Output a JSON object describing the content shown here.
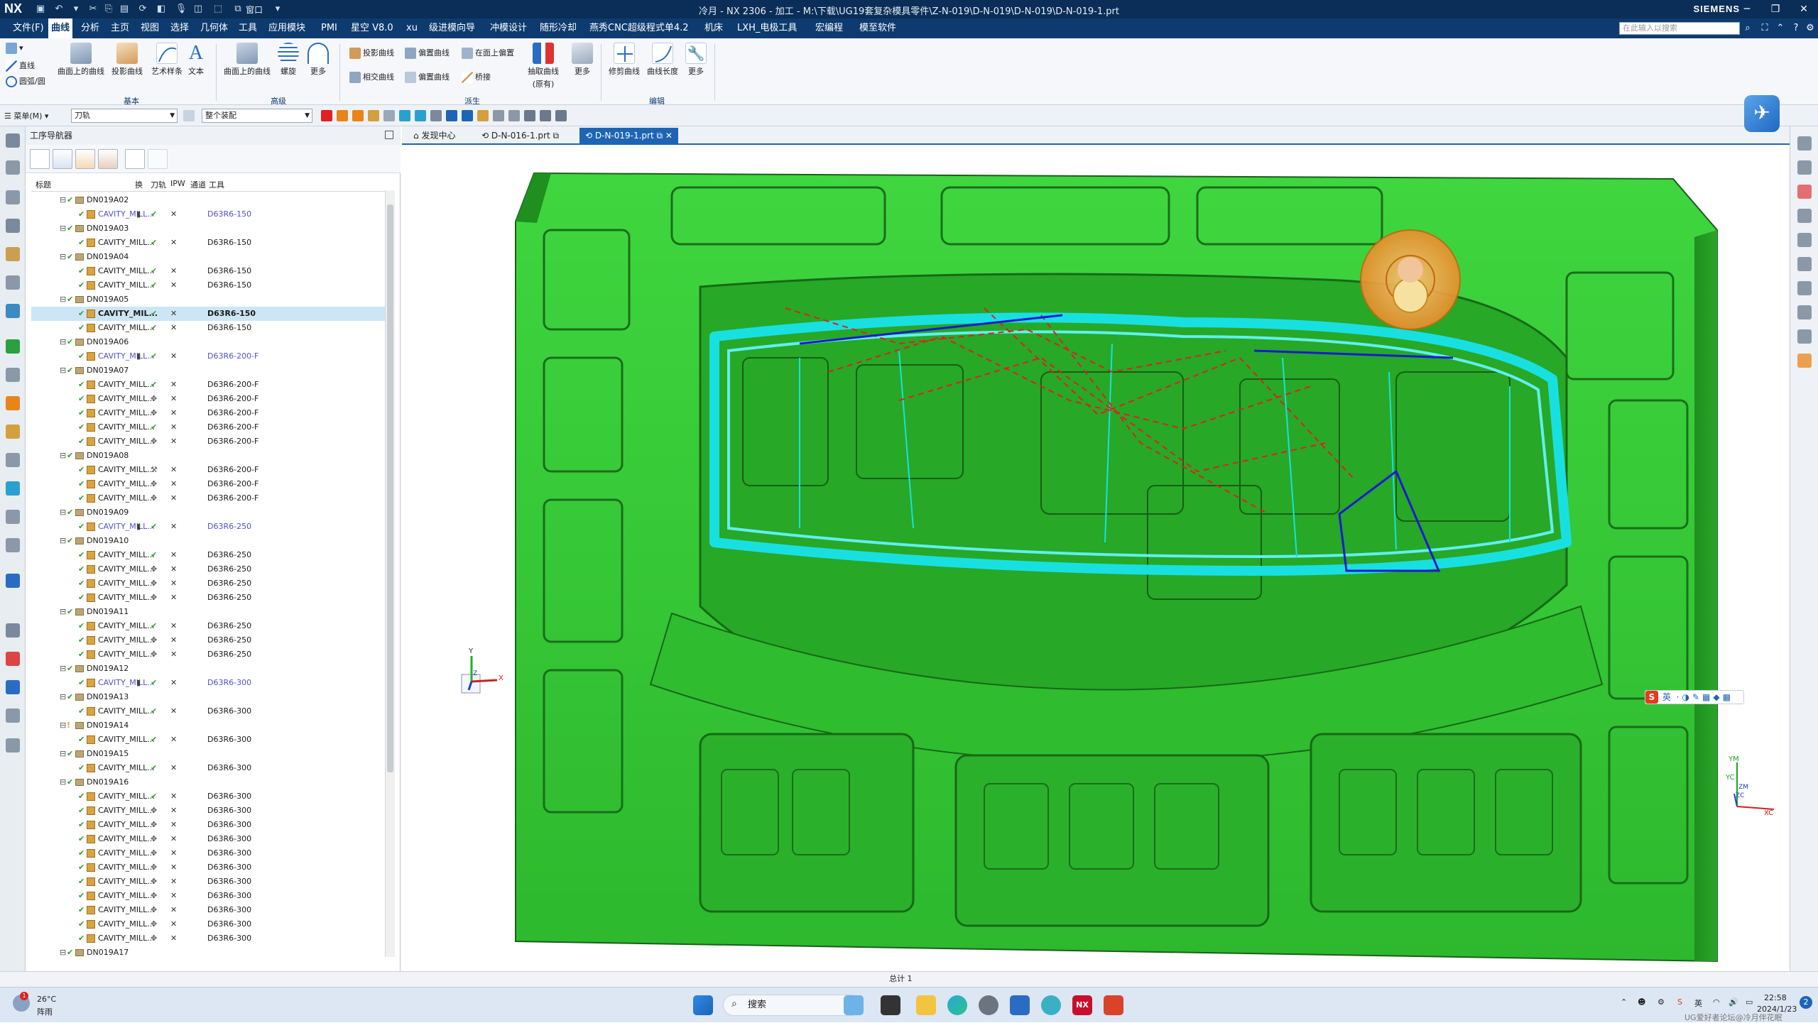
{
  "app": {
    "logo": "NX",
    "title": "冷月 - NX 2306 - 加工 - M:\\下载\\UG19套复杂模具零件\\Z-N-019\\D-N-019\\D-N-019\\D-N-019-1.prt",
    "brand": "SIEMENS",
    "window_menu": "窗口",
    "accent": "#0d3b6f"
  },
  "menu": {
    "items": [
      "文件(F)",
      "曲线",
      "分析",
      "主页",
      "视图",
      "选择",
      "几何体",
      "工具",
      "应用模块",
      "PMI",
      "星空 V8.0",
      "xu",
      "级进模向导",
      "冲模设计",
      "随形冷却",
      "燕秀CNC超级程式单4.2",
      "机床",
      "LXH_电极工具",
      "宏编程",
      "模至软件"
    ],
    "active_index": 1,
    "search_placeholder": "在此输入以搜索"
  },
  "ribbon": {
    "small_buttons": [
      "直线",
      "圆弧/圆"
    ],
    "basic": [
      "曲面上的曲线",
      "投影曲线",
      "艺术样条",
      "文本"
    ],
    "advanced": [
      "曲面上的曲线",
      "螺旋",
      "更多"
    ],
    "derived_small": [
      "投影曲线",
      "相交曲线",
      "偏置曲线",
      "在面上偏置",
      "桥接"
    ],
    "derived_large": [
      "抽取曲线",
      "(原有)"
    ],
    "derived_more": "更多",
    "edit": [
      "修剪曲线",
      "曲线长度",
      "更多"
    ],
    "groups": [
      "基本",
      "高级",
      "派生",
      "编辑"
    ]
  },
  "selection_bar": {
    "menu": "菜单(M)",
    "filter1": "刀轨",
    "filter2": "整个装配"
  },
  "navigator": {
    "title": "工序导航器",
    "columns": [
      "标题",
      "换",
      "刀轨",
      "IPW",
      "通道",
      "工具"
    ],
    "rows": [
      {
        "t": "g",
        "name": "DN019A02"
      },
      {
        "t": "o",
        "name": "CAVITY_MILL...",
        "cg": "▮",
        "path": "✔",
        "ipw": "✕",
        "tool": "D63R6-150",
        "blue": true
      },
      {
        "t": "g",
        "name": "DN019A03"
      },
      {
        "t": "o",
        "name": "CAVITY_MILL...",
        "path": "✔",
        "ipw": "✕",
        "tool": "D63R6-150"
      },
      {
        "t": "g",
        "name": "DN019A04"
      },
      {
        "t": "o",
        "name": "CAVITY_MILL...",
        "path": "✔",
        "ipw": "✕",
        "tool": "D63R6-150"
      },
      {
        "t": "o",
        "name": "CAVITY_MILL...",
        "path": "✔",
        "ipw": "✕",
        "tool": "D63R6-150"
      },
      {
        "t": "g",
        "name": "DN019A05"
      },
      {
        "t": "o",
        "name": "CAVITY_MIL...",
        "path": "✔",
        "ipw": "✕",
        "tool": "D63R6-150",
        "sel": true
      },
      {
        "t": "o",
        "name": "CAVITY_MILL...",
        "path": "✔",
        "ipw": "✕",
        "tool": "D63R6-150"
      },
      {
        "t": "g",
        "name": "DN019A06"
      },
      {
        "t": "o",
        "name": "CAVITY_MILL...",
        "cg": "▮",
        "path": "✔",
        "ipw": "✕",
        "tool": "D63R6-200-F",
        "blue": true
      },
      {
        "t": "g",
        "name": "DN019A07"
      },
      {
        "t": "o",
        "name": "CAVITY_MILL...",
        "path": "✔",
        "ipw": "✕",
        "tool": "D63R6-200-F"
      },
      {
        "t": "o",
        "name": "CAVITY_MILL...",
        "path": "✥",
        "ipw": "✕",
        "tool": "D63R6-200-F"
      },
      {
        "t": "o",
        "name": "CAVITY_MILL...",
        "path": "✥",
        "ipw": "✕",
        "tool": "D63R6-200-F"
      },
      {
        "t": "o",
        "name": "CAVITY_MILL...",
        "path": "✔",
        "ipw": "✕",
        "tool": "D63R6-200-F"
      },
      {
        "t": "o",
        "name": "CAVITY_MILL...",
        "path": "✥",
        "ipw": "✕",
        "tool": "D63R6-200-F"
      },
      {
        "t": "g",
        "name": "DN019A08"
      },
      {
        "t": "o",
        "name": "CAVITY_MILL...",
        "path": "⚒",
        "ipw": "✕",
        "tool": "D63R6-200-F"
      },
      {
        "t": "o",
        "name": "CAVITY_MILL...",
        "path": "✥",
        "ipw": "✕",
        "tool": "D63R6-200-F"
      },
      {
        "t": "o",
        "name": "CAVITY_MILL...",
        "path": "✥",
        "ipw": "✕",
        "tool": "D63R6-200-F"
      },
      {
        "t": "g",
        "name": "DN019A09"
      },
      {
        "t": "o",
        "name": "CAVITY_MILL...",
        "cg": "▮",
        "path": "✔",
        "ipw": "✕",
        "tool": "D63R6-250",
        "blue": true
      },
      {
        "t": "g",
        "name": "DN019A10"
      },
      {
        "t": "o",
        "name": "CAVITY_MILL...",
        "path": "✔",
        "ipw": "✕",
        "tool": "D63R6-250"
      },
      {
        "t": "o",
        "name": "CAVITY_MILL...",
        "path": "✥",
        "ipw": "✕",
        "tool": "D63R6-250"
      },
      {
        "t": "o",
        "name": "CAVITY_MILL...",
        "path": "✥",
        "ipw": "✕",
        "tool": "D63R6-250"
      },
      {
        "t": "o",
        "name": "CAVITY_MILL...",
        "path": "✥",
        "ipw": "✕",
        "tool": "D63R6-250"
      },
      {
        "t": "g",
        "name": "DN019A11"
      },
      {
        "t": "o",
        "name": "CAVITY_MILL...",
        "path": "✔",
        "ipw": "✕",
        "tool": "D63R6-250"
      },
      {
        "t": "o",
        "name": "CAVITY_MILL...",
        "path": "✥",
        "ipw": "✕",
        "tool": "D63R6-250"
      },
      {
        "t": "o",
        "name": "CAVITY_MILL...",
        "path": "✥",
        "ipw": "✕",
        "tool": "D63R6-250"
      },
      {
        "t": "g",
        "name": "DN019A12"
      },
      {
        "t": "o",
        "name": "CAVITY_MILL...",
        "cg": "▮",
        "path": "✔",
        "ipw": "✕",
        "tool": "D63R6-300",
        "blue": true
      },
      {
        "t": "g",
        "name": "DN019A13"
      },
      {
        "t": "o",
        "name": "CAVITY_MILL...",
        "path": "✔",
        "ipw": "✕",
        "tool": "D63R6-300"
      },
      {
        "t": "g",
        "name": "DN019A14",
        "warn": true
      },
      {
        "t": "o",
        "name": "CAVITY_MILL...",
        "path": "✔",
        "ipw": "✕",
        "tool": "D63R6-300"
      },
      {
        "t": "g",
        "name": "DN019A15"
      },
      {
        "t": "o",
        "name": "CAVITY_MILL...",
        "path": "✔",
        "ipw": "✕",
        "tool": "D63R6-300"
      },
      {
        "t": "g",
        "name": "DN019A16"
      },
      {
        "t": "o",
        "name": "CAVITY_MILL...",
        "path": "✔",
        "ipw": "✕",
        "tool": "D63R6-300"
      },
      {
        "t": "o",
        "name": "CAVITY_MILL...",
        "path": "✥",
        "ipw": "✕",
        "tool": "D63R6-300"
      },
      {
        "t": "o",
        "name": "CAVITY_MILL...",
        "path": "✥",
        "ipw": "✕",
        "tool": "D63R6-300"
      },
      {
        "t": "o",
        "name": "CAVITY_MILL...",
        "path": "✥",
        "ipw": "✕",
        "tool": "D63R6-300"
      },
      {
        "t": "o",
        "name": "CAVITY_MILL...",
        "path": "✥",
        "ipw": "✕",
        "tool": "D63R6-300"
      },
      {
        "t": "o",
        "name": "CAVITY_MILL...",
        "path": "✥",
        "ipw": "✕",
        "tool": "D63R6-300"
      },
      {
        "t": "o",
        "name": "CAVITY_MILL...",
        "path": "✥",
        "ipw": "✕",
        "tool": "D63R6-300"
      },
      {
        "t": "o",
        "name": "CAVITY_MILL...",
        "path": "✥",
        "ipw": "✕",
        "tool": "D63R6-300"
      },
      {
        "t": "o",
        "name": "CAVITY_MILL...",
        "path": "✥",
        "ipw": "✕",
        "tool": "D63R6-300"
      },
      {
        "t": "o",
        "name": "CAVITY_MILL...",
        "path": "✥",
        "ipw": "✕",
        "tool": "D63R6-300"
      },
      {
        "t": "o",
        "name": "CAVITY_MILL...",
        "path": "✥",
        "ipw": "✕",
        "tool": "D63R6-300"
      },
      {
        "t": "g",
        "name": "DN019A17"
      }
    ]
  },
  "tabs": [
    "发现中心",
    "D-N-016-1.prt",
    "D-N-019-1.prt"
  ],
  "active_tab": 2,
  "viewport": {
    "model_color": "#33cc33",
    "toolpath_color": "#19e0e0",
    "tool_color": "#f2a23a",
    "triad": {
      "x": "X",
      "y": "Y",
      "z": "Z"
    },
    "wcs": {
      "ym": "YM",
      "yc": "YC",
      "zm": "ZM",
      "zc": "ZC",
      "xc": "XC"
    },
    "ime": "英"
  },
  "status": {
    "text": "总计 1"
  },
  "taskbar": {
    "weather_temp": "26°C",
    "weather_desc": "阵雨",
    "search": "搜索",
    "time": "22:58",
    "date": "2024/1/23",
    "watermark": "UG爱好者论坛@冷月伴花眠"
  }
}
